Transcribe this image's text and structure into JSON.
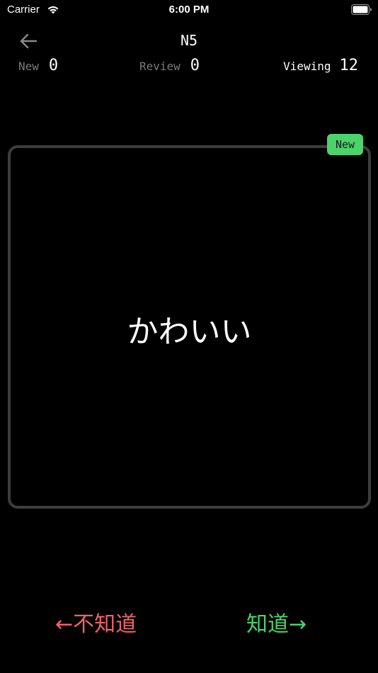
{
  "status_bar": {
    "carrier": "Carrier",
    "time": "6:00 PM"
  },
  "header": {
    "title": "N5"
  },
  "stats": {
    "new_label": "New",
    "new_value": "0",
    "review_label": "Review",
    "review_value": "0",
    "viewing_label": "Viewing",
    "viewing_value": "12"
  },
  "card": {
    "word": "かわいい",
    "badge": "New"
  },
  "actions": {
    "dont_know": "←不知道",
    "know": "知道→"
  },
  "colors": {
    "background": "#000000",
    "card_border": "#3d3d3d",
    "badge": "#4cd36b",
    "know": "#4cd36b",
    "dont_know": "#f2626a",
    "muted_label": "#7a7a7a"
  },
  "icons": {
    "back": "arrow-left-icon",
    "wifi": "wifi-icon",
    "battery": "battery-icon"
  }
}
